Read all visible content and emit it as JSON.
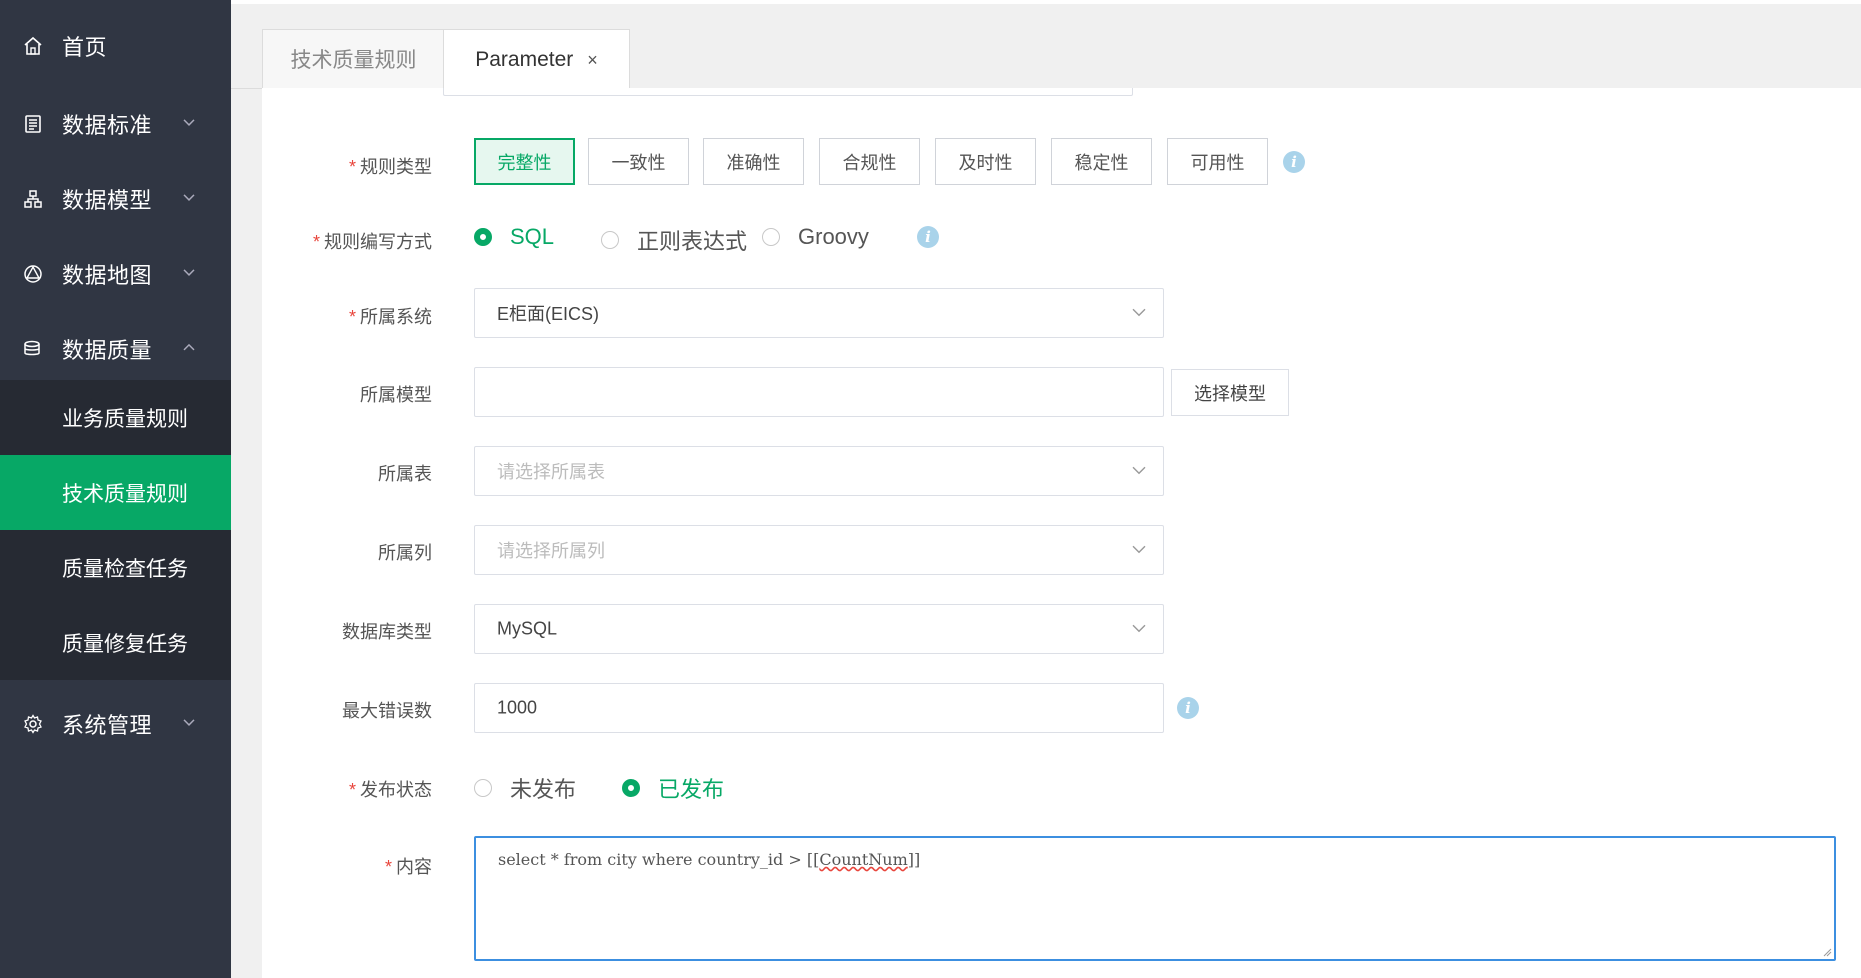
{
  "sidebar": {
    "items": [
      {
        "label": "首页",
        "icon": "home-icon"
      },
      {
        "label": "数据标准",
        "icon": "document-icon"
      },
      {
        "label": "数据模型",
        "icon": "model-icon"
      },
      {
        "label": "数据地图",
        "icon": "map-icon"
      },
      {
        "label": "数据质量",
        "icon": "database-icon"
      },
      {
        "label": "系统管理",
        "icon": "gear-icon"
      }
    ],
    "subitems": [
      {
        "label": "业务质量规则"
      },
      {
        "label": "技术质量规则"
      },
      {
        "label": "质量检查任务"
      },
      {
        "label": "质量修复任务"
      }
    ],
    "active_subitem": "技术质量规则",
    "accent": "#07a866"
  },
  "tabs": [
    {
      "label": "技术质量规则"
    },
    {
      "label": "Parameter",
      "close": "×"
    }
  ],
  "form": {
    "rule_type": {
      "label": "规则类型",
      "options": [
        "完整性",
        "一致性",
        "准确性",
        "合规性",
        "及时性",
        "稳定性",
        "可用性"
      ],
      "selected": "完整性"
    },
    "write_mode": {
      "label": "规则编写方式",
      "options": [
        "SQL",
        "正则表达式",
        "Groovy"
      ],
      "selected": "SQL"
    },
    "system": {
      "label": "所属系统",
      "value": "E柜面(EICS)"
    },
    "model": {
      "label": "所属模型",
      "value": "",
      "button": "选择模型"
    },
    "table": {
      "label": "所属表",
      "placeholder": "请选择所属表"
    },
    "column": {
      "label": "所属列",
      "placeholder": "请选择所属列"
    },
    "db_type": {
      "label": "数据库类型",
      "value": "MySQL"
    },
    "max_errors": {
      "label": "最大错误数",
      "value": "1000"
    },
    "publish": {
      "label": "发布状态",
      "options": [
        "未发布",
        "已发布"
      ],
      "selected": "已发布"
    },
    "content": {
      "label": "内容",
      "sql_prefix": "select * from city where country_id >",
      "sql_open": " [[",
      "sql_param": "CountNum",
      "sql_close": "]]"
    }
  }
}
